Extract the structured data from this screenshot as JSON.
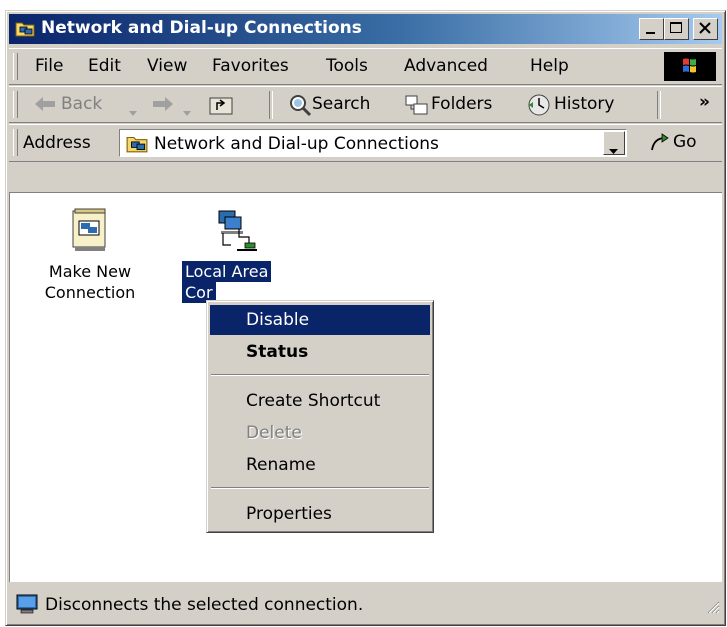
{
  "window": {
    "title": "Network and Dial-up Connections"
  },
  "menu": {
    "items": [
      "File",
      "Edit",
      "View",
      "Favorites",
      "Tools",
      "Advanced",
      "Help"
    ]
  },
  "toolbar": {
    "back": "Back",
    "search": "Search",
    "folders": "Folders",
    "history": "History",
    "more": "»"
  },
  "address": {
    "label": "Address",
    "value": "Network and Dial-up Connections",
    "go": "Go"
  },
  "icons": {
    "make_new_line1": "Make New",
    "make_new_line2": "Connection",
    "local_line1": "Local Area",
    "local_line2": "Cor"
  },
  "context_menu": {
    "items": [
      "Disable",
      "Status",
      "Create Shortcut",
      "Delete",
      "Rename",
      "Properties"
    ],
    "highlighted": "Disable",
    "default": "Status",
    "disabled": [
      "Delete"
    ]
  },
  "status_bar": {
    "text": "Disconnects the selected connection."
  },
  "colors": {
    "title_start": "#0a246a",
    "title_end": "#a6caf0",
    "face": "#d4d0c8",
    "highlight": "#0a246a"
  }
}
